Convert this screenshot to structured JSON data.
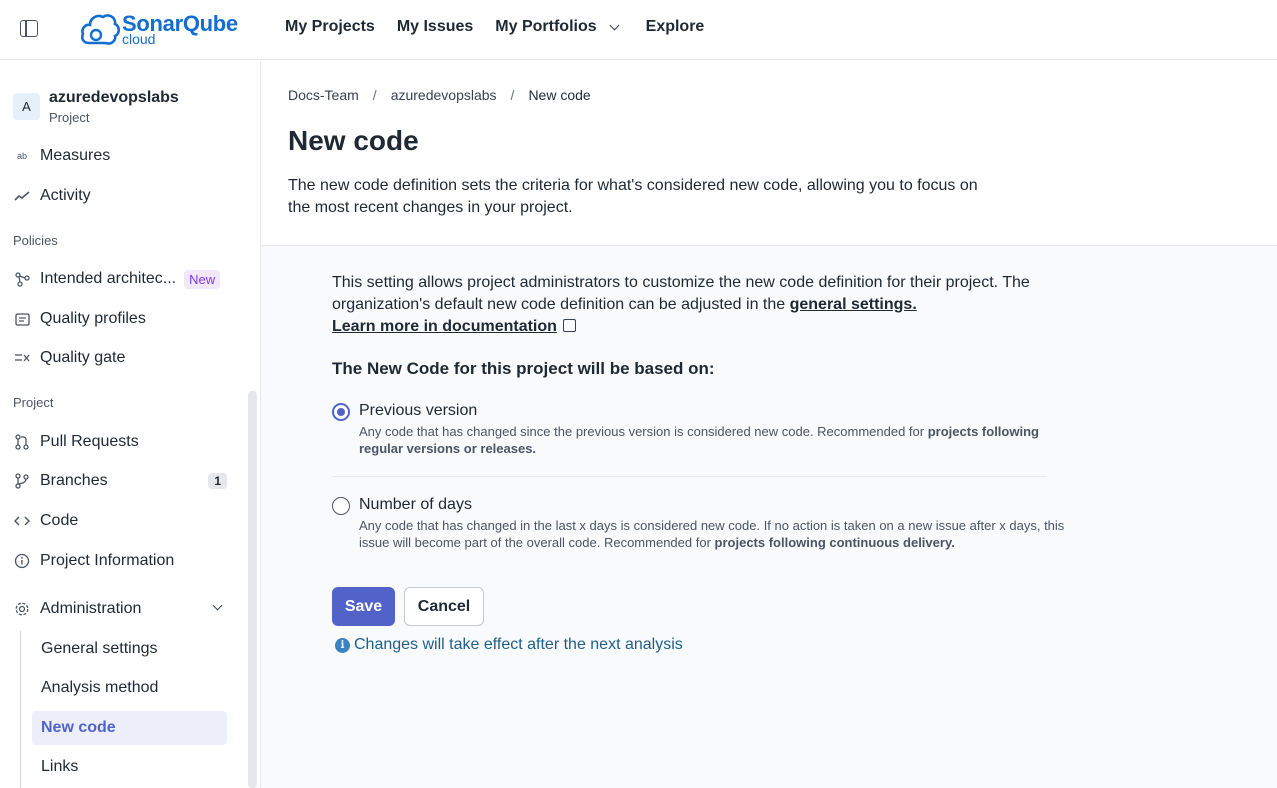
{
  "header": {
    "logo_word": "SonarQube",
    "logo_sub": "cloud",
    "nav": [
      {
        "label": "My Projects"
      },
      {
        "label": "My Issues"
      },
      {
        "label": "My Portfolios"
      },
      {
        "label": "Explore"
      }
    ]
  },
  "sidebar": {
    "project_avatar": "A",
    "project_name": "azuredevopslabs",
    "project_type": "Project",
    "items_top": [
      {
        "label": "Measures",
        "icon": "measures-icon"
      },
      {
        "label": "Activity",
        "icon": "activity-icon"
      }
    ],
    "policies_label": "Policies",
    "policies": [
      {
        "label": "Intended architec...",
        "badge": "New"
      },
      {
        "label": "Quality profiles"
      },
      {
        "label": "Quality gate"
      }
    ],
    "project_label": "Project",
    "project_items": [
      {
        "label": "Pull Requests"
      },
      {
        "label": "Branches",
        "count": "1"
      },
      {
        "label": "Code"
      },
      {
        "label": "Project Information"
      }
    ],
    "administration": "Administration",
    "admin_items": [
      {
        "label": "General settings"
      },
      {
        "label": "Analysis method"
      },
      {
        "label": "New code"
      },
      {
        "label": "Links"
      }
    ]
  },
  "breadcrumb": [
    "Docs-Team",
    "/",
    "azuredevopslabs",
    "/",
    "New code"
  ],
  "page": {
    "title": "New code",
    "description": "The new code definition sets the criteria for what's considered new code, allowing you to focus on the most recent changes in your project.",
    "info_text": "This setting allows project administrators to customize the new code definition for their project. The organization's default new code definition can be adjusted in the",
    "info_link": "general settings.",
    "learn_more": "Learn more in documentation",
    "based_on": "The New Code for this project will be based on:",
    "options": [
      {
        "title": "Previous version",
        "desc": "Any code that has changed since the previous version is considered new code. Recommended for",
        "desc_bold": "projects following regular versions or releases.",
        "selected": true
      },
      {
        "title": "Number of days",
        "desc": "Any code that has changed in the last x days is considered new code. If no action is taken on a new issue after x days, this issue will become part of the overall code. Recommended for",
        "desc_bold": "projects following continuous delivery.",
        "selected": false
      }
    ],
    "save": "Save",
    "cancel": "Cancel",
    "note": "Changes will take effect after the next analysis"
  },
  "colors": {
    "accent": "#5163c9",
    "brand": "#126ed3",
    "note": "#1e5f8a"
  }
}
